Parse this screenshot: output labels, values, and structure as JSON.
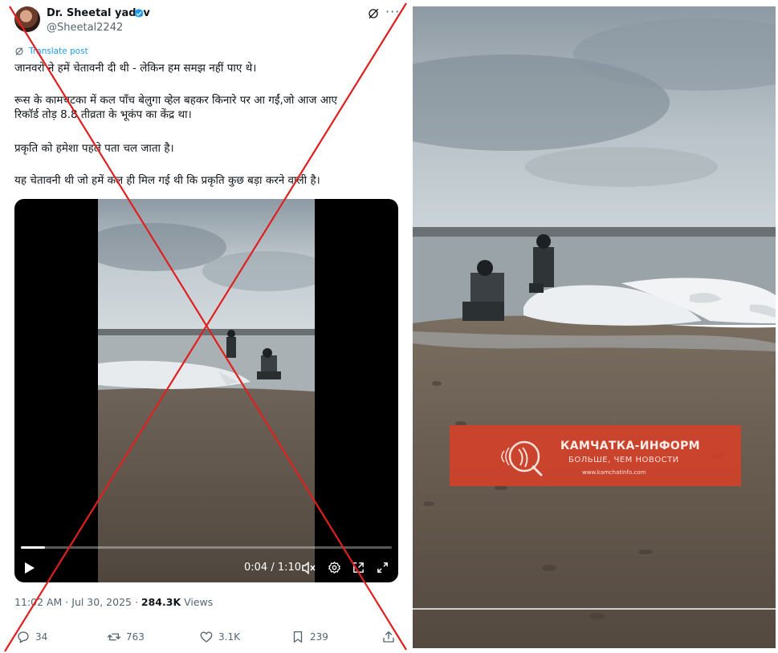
{
  "tweet": {
    "author": {
      "name": "Dr. Sheetal yadav",
      "handle": "@Sheetal2242",
      "verified": true
    },
    "translate_label": "Translate post",
    "text_lines": [
      "जानवरों ने हमें चेतावनी दी थी - लेकिन हम समझ नहीं पाए थे।",
      "रूस के कामचटका में कल पाँच बेलुगा व्हेल बहकर किनारे पर आ गईं,जो आज आए",
      "रिकॉर्ड तोड़ 8.8 तीव्रता के भूकंप का केंद्र था।",
      "प्रकृति को हमेशा पहले पता चल जाता है।",
      "यह चेतावनी थी जो हमें कल ही मिल गई थी कि प्रकृति कुछ बड़ा करने वाली है।"
    ],
    "video": {
      "time": "0:04 / 1:10",
      "progress": 0.065
    },
    "posted": "11:02 AM · Jul 30, 2025 · ",
    "views_count": "284.3K",
    "views_label": " Views",
    "stats": {
      "replies": "34",
      "reposts": "763",
      "likes": "3.1K",
      "bookmarks": "239"
    },
    "colors": {
      "link_blue": "#1d9bf0",
      "muted": "#536471",
      "text": "#0f1419",
      "cross_red": "#e0201f"
    }
  },
  "still_watermark": {
    "title": "КАМЧАТКА-ИНФОРМ",
    "subtitle": "БОЛЬШЕ, ЧЕМ НОВОСТИ",
    "url": "www.kamchatinfo.com",
    "color": "#d64028"
  }
}
